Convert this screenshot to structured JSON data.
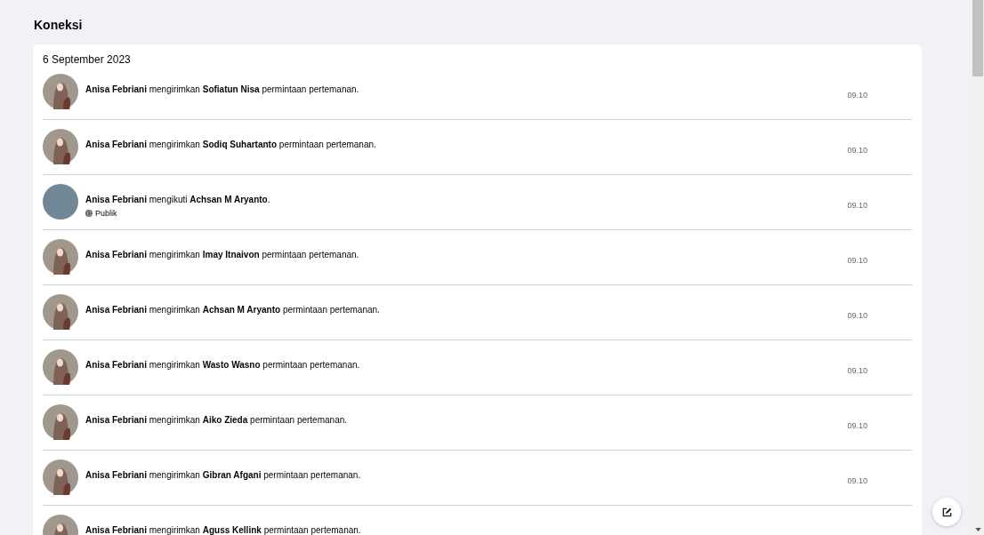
{
  "page": {
    "title": "Koneksi"
  },
  "feed": {
    "date": "6 September 2023",
    "items": [
      {
        "avatar": {
          "kind": "illustration",
          "color": "#a0978d"
        },
        "text": "**Anisa Febriani** mengirimkan **Sofiatun Nisa** permintaan pertemanan.",
        "time": "09.10"
      },
      {
        "avatar": {
          "kind": "illustration",
          "color": "#a0978d"
        },
        "text": "**Anisa Febriani** mengirimkan **Sodiq Suhartanto** permintaan pertemanan.",
        "time": "09.10"
      },
      {
        "avatar": {
          "kind": "photo",
          "color": "#6f8796"
        },
        "text": "**Anisa Febriani** mengikuti **Achsan M Aryanto**.",
        "privacy": "Publik",
        "time": "09.10"
      },
      {
        "avatar": {
          "kind": "illustration",
          "color": "#a0978d"
        },
        "text": "**Anisa Febriani** mengirimkan **Imay Itnaivon** permintaan pertemanan.",
        "time": "09.10"
      },
      {
        "avatar": {
          "kind": "illustration",
          "color": "#a0978d"
        },
        "text": "**Anisa Febriani** mengirimkan **Achsan M Aryanto** permintaan pertemanan.",
        "time": "09.10"
      },
      {
        "avatar": {
          "kind": "illustration",
          "color": "#a0978d"
        },
        "text": "**Anisa Febriani** mengirimkan **Wasto Wasno** permintaan pertemanan.",
        "time": "09.10"
      },
      {
        "avatar": {
          "kind": "illustration",
          "color": "#a0978d"
        },
        "text": "**Anisa Febriani** mengirimkan **Aiko Zieda** permintaan pertemanan.",
        "time": "09.10"
      },
      {
        "avatar": {
          "kind": "illustration",
          "color": "#a0978d"
        },
        "text": "**Anisa Febriani** mengirimkan **Gibran Afgani** permintaan pertemanan.",
        "time": "09.10"
      },
      {
        "avatar": {
          "kind": "illustration",
          "color": "#a0978d"
        },
        "text": "**Anisa Febriani** mengirimkan **Aguss Kellink** permintaan pertemanan."
      }
    ]
  }
}
